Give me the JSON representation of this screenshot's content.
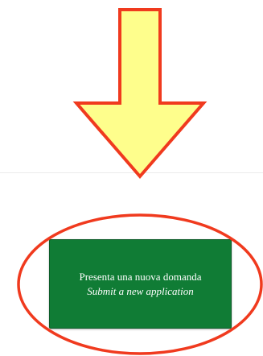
{
  "button": {
    "label_it": "Presenta una nuova domanda",
    "label_en": "Submit a new application"
  },
  "colors": {
    "arrow_fill": "#fefe8c",
    "arrow_stroke": "#f03a1e",
    "ellipse_stroke": "#f03a1e",
    "button_bg": "#107c35",
    "button_text": "#ffffff"
  },
  "icons": {
    "arrow": "down-arrow-icon",
    "ellipse": "highlight-ellipse"
  }
}
